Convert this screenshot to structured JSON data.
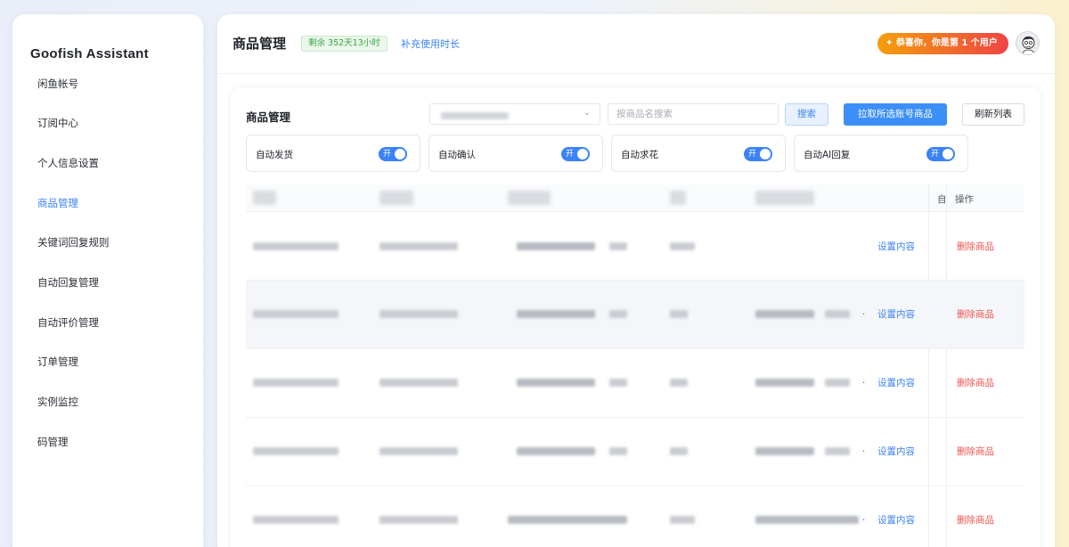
{
  "app": {
    "title": "Goofish Assistant"
  },
  "sidebar": {
    "items": [
      {
        "label": "闲鱼帐号"
      },
      {
        "label": "订阅中心"
      },
      {
        "label": "个人信息设置"
      },
      {
        "label": "商品管理",
        "active": true
      },
      {
        "label": "关键词回复规则"
      },
      {
        "label": "自动回复管理"
      },
      {
        "label": "自动评价管理"
      },
      {
        "label": "订单管理"
      },
      {
        "label": "实例监控"
      },
      {
        "label": "码管理"
      }
    ]
  },
  "header": {
    "title": "商品管理",
    "remaining_badge": "剩余 352天13小时",
    "renew_link": "补充使用时长",
    "congrats": "✦ 恭喜你，你是第 1 个用户"
  },
  "card": {
    "title": "商品管理",
    "search_placeholder": "按商品名搜索",
    "search_button": "搜索",
    "fetch_button": "拉取所选账号商品",
    "refresh_button": "刷新列表",
    "toggles": [
      {
        "label": "自动发货",
        "state": "开"
      },
      {
        "label": "自动确认",
        "state": "开"
      },
      {
        "label": "自动求花",
        "state": "开"
      },
      {
        "label": "自动AI回复",
        "state": "开"
      }
    ]
  },
  "table": {
    "header_auto": "自",
    "header_ops": "操作",
    "rows": [
      {
        "setup": "设置内容",
        "delete": "删除商品"
      },
      {
        "setup": "设置内容",
        "delete": "删除商品"
      },
      {
        "setup": "设置内容",
        "delete": "删除商品"
      },
      {
        "setup": "设置内容",
        "delete": "删除商品"
      },
      {
        "setup": "设置内容",
        "delete": "删除商品"
      }
    ]
  },
  "colors": {
    "accent": "#3b82f6",
    "danger": "#ef5350",
    "success": "#3aa346"
  }
}
